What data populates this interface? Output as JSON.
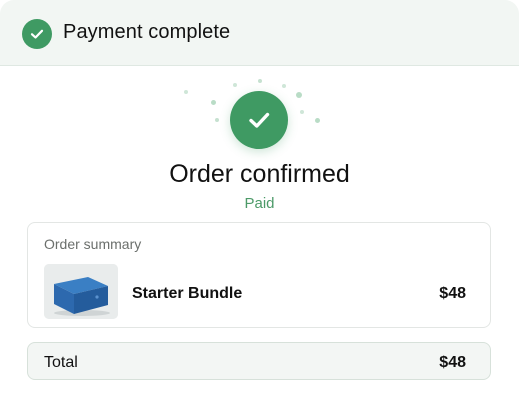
{
  "header": {
    "title": "Payment complete",
    "icon": "check-circle-icon"
  },
  "confirmation": {
    "icon": "check-circle-icon",
    "title": "Order confirmed",
    "status": "Paid"
  },
  "summary": {
    "label": "Order summary",
    "items": [
      {
        "name": "Starter Bundle",
        "price": "$48",
        "thumbnail": "product-box-image"
      }
    ]
  },
  "total": {
    "label": "Total",
    "value": "$48"
  },
  "colors": {
    "accent": "#3f9a63",
    "status": "#4c9a68",
    "header_bg": "#f2f6f3"
  }
}
